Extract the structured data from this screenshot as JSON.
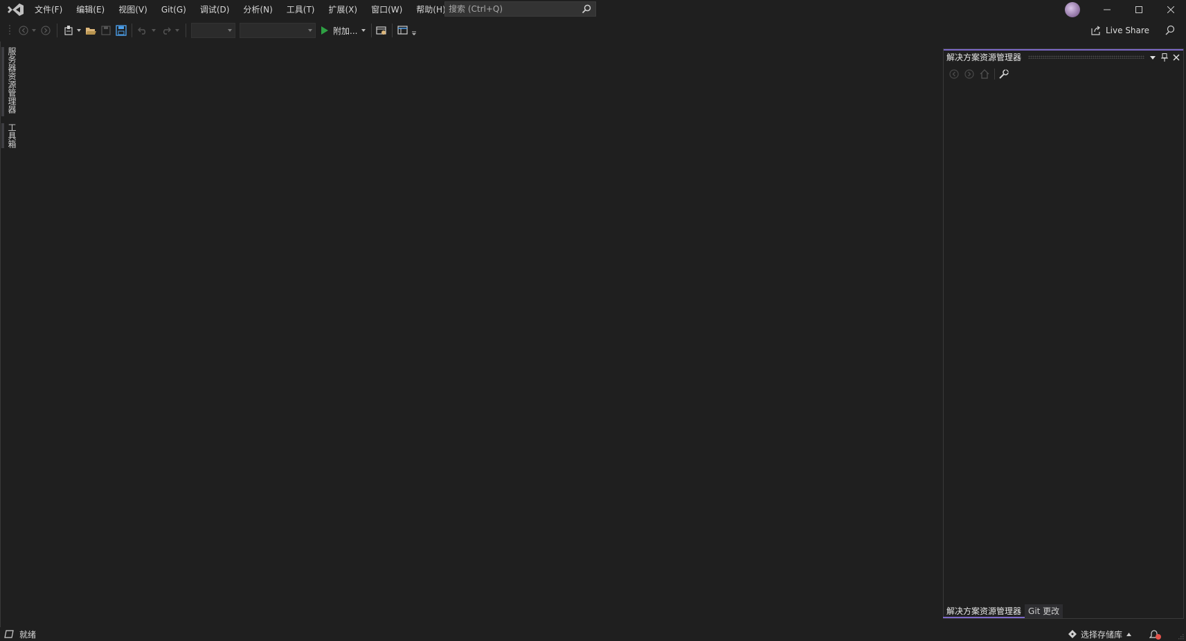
{
  "menu": {
    "items": [
      "文件(F)",
      "编辑(E)",
      "视图(V)",
      "Git(G)",
      "调试(D)",
      "分析(N)",
      "工具(T)",
      "扩展(X)",
      "窗口(W)",
      "帮助(H)"
    ]
  },
  "search": {
    "placeholder": "搜索 (Ctrl+Q)"
  },
  "toolbar": {
    "attach_label": "附加..."
  },
  "live_share": {
    "label": "Live Share"
  },
  "left_tabs": {
    "server_explorer": "服务器资源管理器",
    "toolbox": "工具箱"
  },
  "solution_explorer": {
    "title": "解决方案资源管理器",
    "tabs": [
      "解决方案资源管理器",
      "Git 更改"
    ]
  },
  "status": {
    "ready": "就绪",
    "repo": "选择存储库"
  },
  "colors": {
    "accent": "#7c68c9",
    "run": "#2ea043",
    "folder": "#dcb67a",
    "save": "#4b9fea",
    "badge": "#e5534b"
  },
  "icons": [
    "vs-logo-icon",
    "search-icon",
    "minimize-icon",
    "maximize-icon",
    "close-icon",
    "back-icon",
    "forward-icon",
    "new-project-icon",
    "open-folder-icon",
    "save-icon",
    "save-all-icon",
    "undo-icon",
    "redo-icon",
    "start-icon",
    "browser-link-icon",
    "layout-icon",
    "live-share-icon",
    "feedback-icon",
    "dropdown-icon",
    "pin-icon",
    "home-icon",
    "wrench-icon",
    "git-icon",
    "bell-icon"
  ]
}
